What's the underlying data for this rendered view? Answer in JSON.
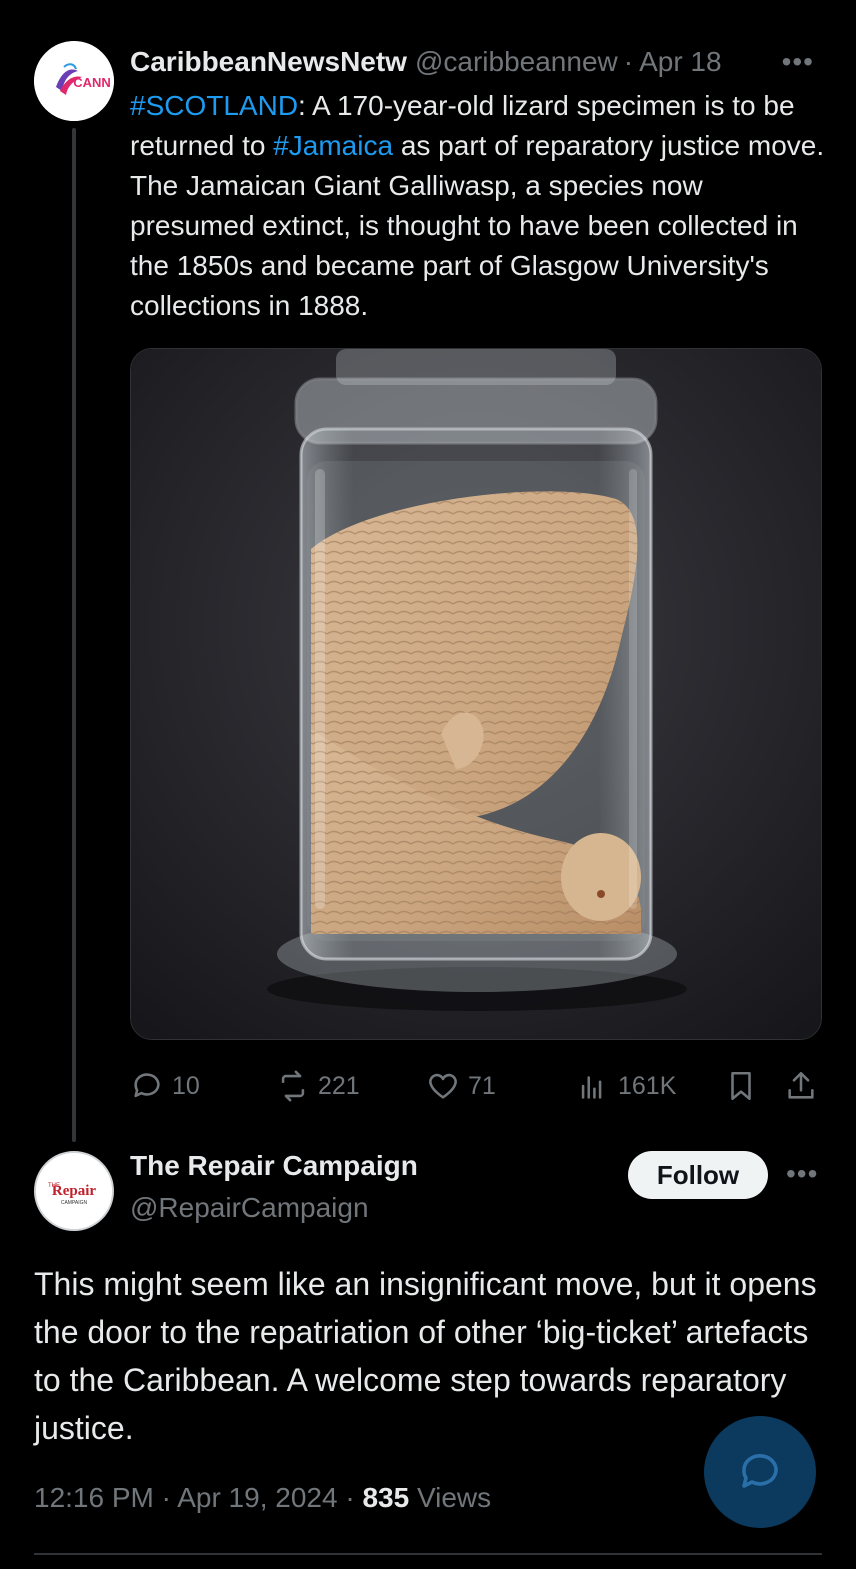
{
  "parent_tweet": {
    "author_name": "CaribbeanNewsNetw",
    "handle": "@caribbeannew",
    "separator": "·",
    "date": "Apr 18",
    "avatar_text": "CANN",
    "text": {
      "tag1": "#SCOTLAND",
      "part1": ": A 170-year-old lizard specimen is to be returned to ",
      "tag2": "#Jamaica",
      "part2": " as part of reparatory justice move. The Jamaican Giant Galliwasp, a species now presumed extinct, is thought to have been collected in the 1850s and became part of Glasgow  University's collections in 1888."
    },
    "metrics": {
      "replies": "10",
      "reposts": "221",
      "likes": "71",
      "views": "161K"
    }
  },
  "main_tweet": {
    "author_name": "The Repair Campaign",
    "handle": "@RepairCampaign",
    "avatar_text_top": "THE",
    "avatar_text_main": "Repair",
    "avatar_text_sub": "CAMPAIGN",
    "follow_label": "Follow",
    "text": "This might seem like an insignificant move, but it opens the door to the repatriation of other ‘big-ticket’ artefacts to the Caribbean. A welcome step towards reparatory justice.",
    "time": "12:16 PM",
    "date": "Apr 19, 2024",
    "views_count": "835",
    "views_label": "Views",
    "separator": "·"
  },
  "icons": {
    "more": "more-horizontal-icon",
    "reply": "reply-icon",
    "repost": "repost-icon",
    "like": "heart-icon",
    "views": "views-icon",
    "bookmark": "bookmark-icon",
    "share": "share-icon",
    "fab": "compose-reply-icon"
  },
  "colors": {
    "background": "#000000",
    "text": "#e7e9ea",
    "secondary": "#71767b",
    "link": "#1d9bf0",
    "fab": "#0b3a5e"
  }
}
